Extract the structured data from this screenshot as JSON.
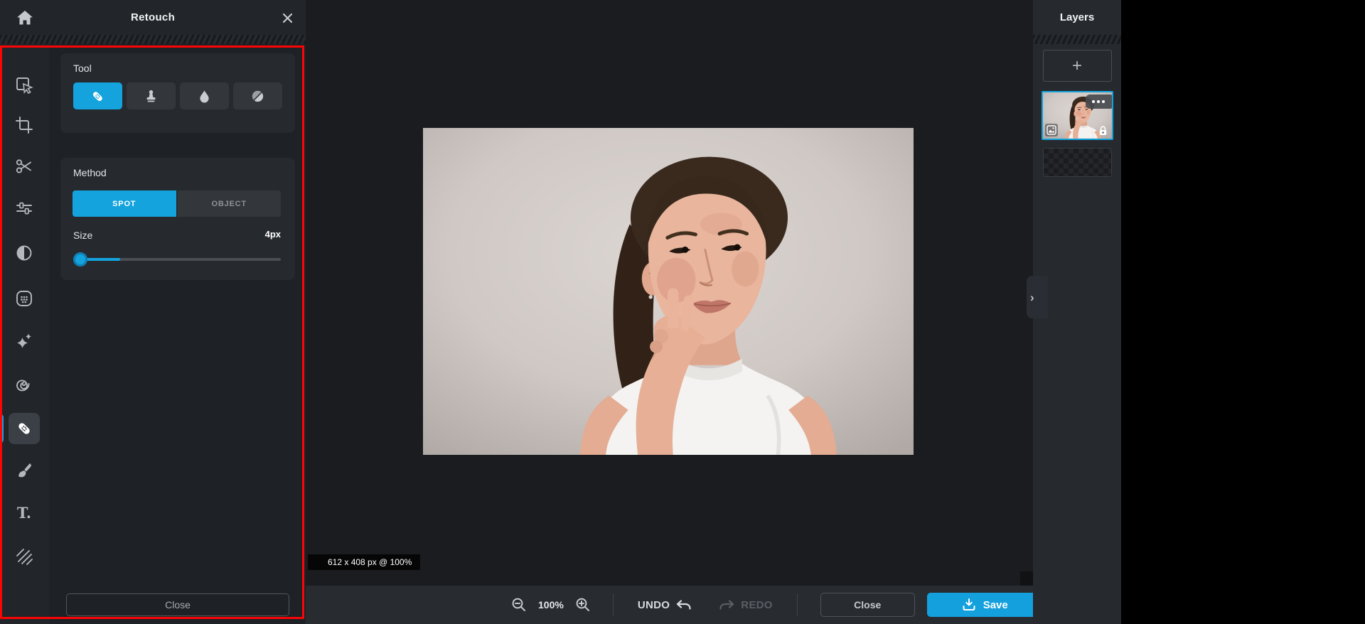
{
  "panel": {
    "title": "Retouch",
    "tool_section": {
      "label": "Tool",
      "tools": [
        {
          "icon": "bandage-icon",
          "active": true
        },
        {
          "icon": "stamp-icon",
          "active": false
        },
        {
          "icon": "droplet-icon",
          "active": false
        },
        {
          "icon": "tonal-circle-icon",
          "active": false
        }
      ]
    },
    "method_section": {
      "label": "Method",
      "options": [
        {
          "label": "SPOT",
          "active": true
        },
        {
          "label": "OBJECT",
          "active": false
        }
      ]
    },
    "size_section": {
      "label": "Size",
      "value": "4px"
    },
    "close_label": "Close"
  },
  "sidebar": {
    "items": [
      {
        "icon": "select-cursor-icon",
        "active": false
      },
      {
        "icon": "crop-icon",
        "active": false
      },
      {
        "icon": "scissors-icon",
        "active": false
      },
      {
        "icon": "sliders-icon",
        "active": false
      },
      {
        "icon": "contrast-icon",
        "active": false
      },
      {
        "icon": "dots-frame-icon",
        "active": false
      },
      {
        "icon": "sparkles-icon",
        "active": false
      },
      {
        "icon": "spiral-icon",
        "active": false
      },
      {
        "icon": "bandage-icon",
        "active": true
      },
      {
        "icon": "brush-icon",
        "active": false
      },
      {
        "icon": "text-icon",
        "active": false
      },
      {
        "icon": "hatch-lines-icon",
        "active": false
      }
    ],
    "text_icon_glyph": "T."
  },
  "canvas": {
    "status": "612 x 408 px @ 100%"
  },
  "bottom_bar": {
    "zoom_level": "100%",
    "undo_label": "UNDO",
    "redo_label": "REDO",
    "close_label": "Close",
    "save_label": "Save"
  },
  "layers": {
    "title": "Layers",
    "add_label": "+",
    "items": [
      {
        "type": "image",
        "selected": true,
        "locked": true,
        "menu": "more-options"
      },
      {
        "type": "transparent",
        "selected": false
      }
    ]
  },
  "colors": {
    "accent_blue": "#14a3dc",
    "annotation_red": "#fb0505",
    "panel_bg": "#1e2125",
    "card_bg": "#26292e",
    "canvas_bg": "#1a1c1f",
    "bar_bg": "#282b30"
  }
}
